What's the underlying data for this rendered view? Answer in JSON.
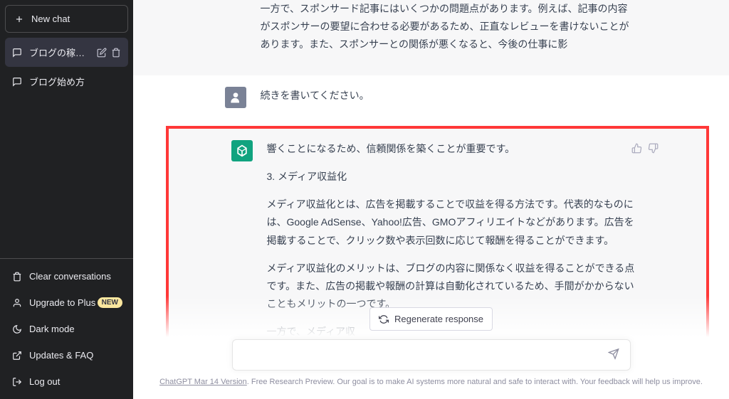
{
  "sidebar": {
    "new_chat": "New chat",
    "chats": [
      {
        "label": "ブログの稼ぎ方",
        "active": true
      },
      {
        "label": "ブログ始め方",
        "active": false
      }
    ],
    "bottom": {
      "clear": "Clear conversations",
      "upgrade": "Upgrade to Plus",
      "upgrade_badge": "NEW",
      "dark": "Dark mode",
      "faq": "Updates & FAQ",
      "logout": "Log out"
    }
  },
  "conversation": {
    "prev_assistant": "一方で、スポンサード記事にはいくつかの問題点があります。例えば、記事の内容がスポンサーの要望に合わせる必要があるため、正直なレビューを書けないことがあります。また、スポンサーとの関係が悪くなると、今後の仕事に影",
    "user_msg": "続きを書いてください。",
    "assistant": {
      "p1": "響くことになるため、信頼関係を築くことが重要です。",
      "p2": "3.  メディア収益化",
      "p3": "メディア収益化とは、広告を掲載することで収益を得る方法です。代表的なものには、Google AdSense、Yahoo!広告、GMOアフィリエイトなどがあります。広告を掲載することで、クリック数や表示回数に応じて報酬を得ることができます。",
      "p4": "メディア収益化のメリットは、ブログの内容に関係なく収益を得ることができる点です。また、広告の掲載や報酬の計算は自動化されているため、手間がかからないこともメリットの一つです。",
      "p5": "一方で、メディア収"
    }
  },
  "controls": {
    "regenerate": "Regenerate response",
    "input_placeholder": ""
  },
  "footer": {
    "version": "ChatGPT Mar 14 Version",
    "text": ". Free Research Preview. Our goal is to make AI systems more natural and safe to interact with. Your feedback will help us improve."
  }
}
